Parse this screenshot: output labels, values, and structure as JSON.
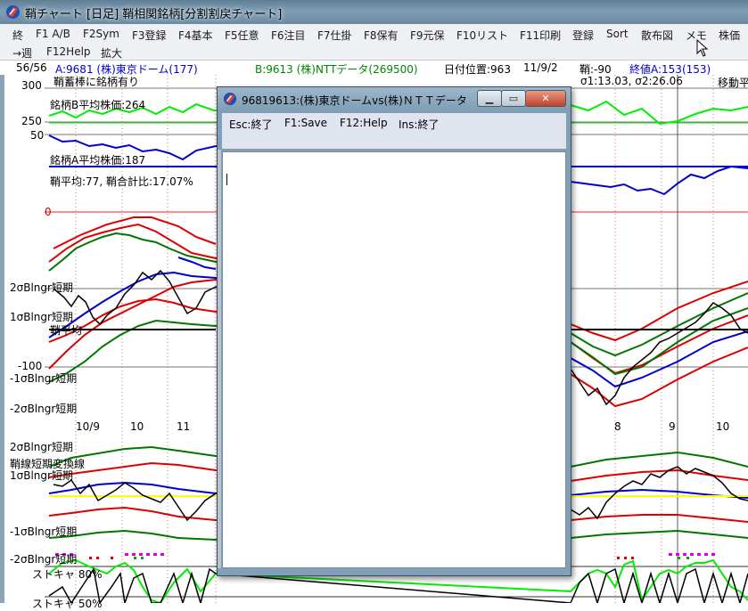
{
  "window": {
    "title": "鞘チャート [日足] 鞘相関銘柄[分割割戻チャート]"
  },
  "menu": {
    "row1": [
      "終",
      "F1 A/B",
      "F2Sym",
      "F3登録",
      "F4基本",
      "F5任意",
      "F6注目",
      "F7仕掛",
      "F8保有",
      "F9元保",
      "F10リスト",
      "F11印刷",
      "登録",
      "Sort",
      "散布図",
      "メモ",
      "株価"
    ],
    "row2": [
      "→週",
      "F12Help",
      "拡大"
    ]
  },
  "info": {
    "count": "56/56",
    "stock_a": "A:9681 (株)東京ドーム(177)",
    "stock_b": "B:9613 (株)NTTデータ(269500)",
    "date_pos": "日付位置:963",
    "date": "11/9/2",
    "spread": "鞘:-90",
    "close_a": "終値A:153(153)",
    "sigma": "σ1:13.03, σ2:26.06",
    "moving": "移動平",
    "bar_note": "鞘蓄棒に銘柄有り"
  },
  "chart_labels": {
    "y300": "300",
    "y250": "250",
    "y50": "50",
    "y0": "0",
    "avg_b": "銘柄B平均株価:264",
    "avg_a": "銘柄A平均株価:187",
    "spread_avg": "鞘平均:77, 鞘合計比:17.07%",
    "bb_p2": "2σBlngr短期",
    "bb_p1": "1σBlngr短期",
    "spread_mean": "鞘平均",
    "y_m100": "-100",
    "bb_m1": "-1σBlngr短期",
    "bb_m2": "-2σBlngr短期",
    "x_10_9": "10/9",
    "x_10": "10",
    "x_11": "11",
    "x_8": "8",
    "x_9": "9",
    "x_10b": "10",
    "bb2_p2": "2σBlngr短期",
    "bb2_trend": "鞘線短期変換線",
    "bb2_p1": "1σBlngr短期",
    "bb2_m1": "-1σBlngr短期",
    "bb2_m2": "-2σBlngr短期",
    "stoch1": "ストキャ 80%",
    "stoch2": "ストキャ 50%"
  },
  "dialog": {
    "title": "96819613:(株)東京ドームvs(株)ＮＴＴデータ",
    "menu": [
      "Esc:終了",
      "F1:Save",
      "F12:Help",
      "Ins:終了"
    ],
    "text": ""
  },
  "colors": {
    "green": "#00ee00",
    "blue": "#0000cc",
    "red": "#dd0000",
    "darkgreen": "#006600",
    "yellow": "#ffff00",
    "magenta": "#dd00dd"
  }
}
